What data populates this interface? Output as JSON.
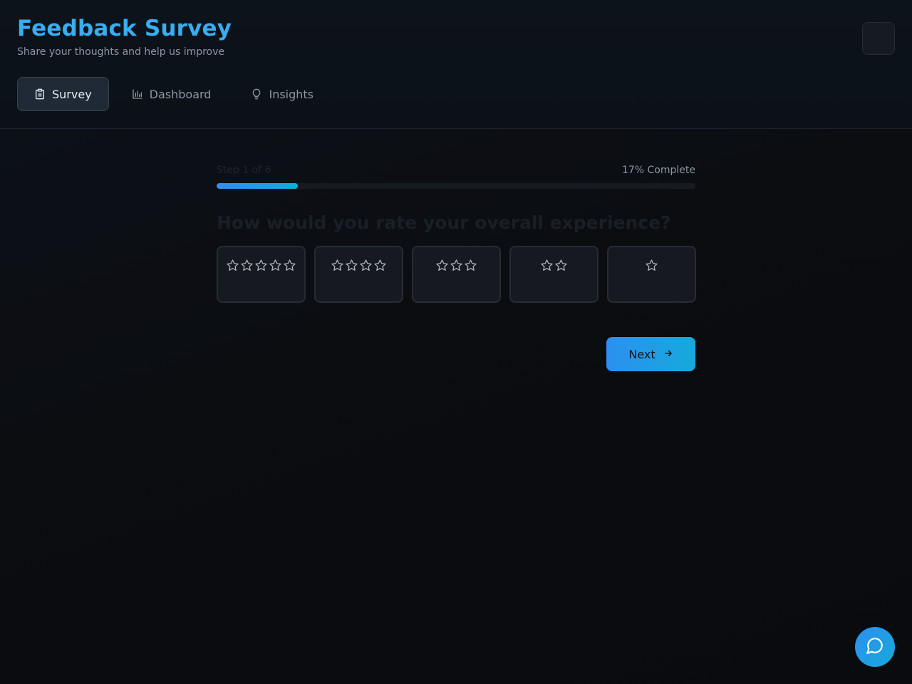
{
  "header": {
    "title": "Feedback Survey",
    "subtitle": "Share your thoughts and help us improve"
  },
  "tabs": [
    {
      "label": "Survey",
      "icon": "clipboard-icon",
      "active": true
    },
    {
      "label": "Dashboard",
      "icon": "bar-chart-icon",
      "active": false
    },
    {
      "label": "Insights",
      "icon": "lightbulb-icon",
      "active": false
    }
  ],
  "progress": {
    "step_label": "Step 1 of 6",
    "percent_label": "17% Complete",
    "fraction": 0.17
  },
  "question": {
    "text": "How would you rate your overall experience?",
    "options": [
      {
        "stars": 5,
        "icon": "star-icon"
      },
      {
        "stars": 4,
        "icon": "star-icon"
      },
      {
        "stars": 3,
        "icon": "star-icon"
      },
      {
        "stars": 2,
        "icon": "star-icon"
      },
      {
        "stars": 1,
        "icon": "star-icon"
      }
    ]
  },
  "next_label": "Next",
  "colors": {
    "accent": "#38aef0",
    "gradient_start": "#2d8ff0",
    "gradient_end": "#15aadb",
    "background": "#0b0d11"
  }
}
